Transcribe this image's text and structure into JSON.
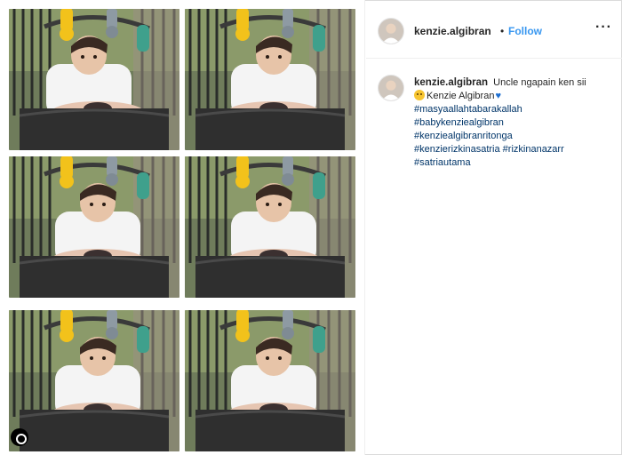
{
  "post": {
    "username": "kenzie.algibran",
    "separator": "•",
    "follow_label": "Follow",
    "more_label": "···"
  },
  "caption": {
    "username": "kenzie.algibran",
    "text_1": "Uncle ngapain ken sii",
    "emoji_1": "confused-face-emoji",
    "text_2": "Kenzie Algibran",
    "emoji_2": "blue-heart-emoji",
    "hashtags": [
      "#masyaallahtabarakallah",
      "#babykenziealgibran",
      "#kenziealgibranritonga",
      "#kenzierizkinasatria",
      "#rizkinanazarr",
      "#satriautama"
    ]
  },
  "media": {
    "tile_count": 6,
    "icons": [
      "multi-photo-indicator-icon"
    ]
  }
}
